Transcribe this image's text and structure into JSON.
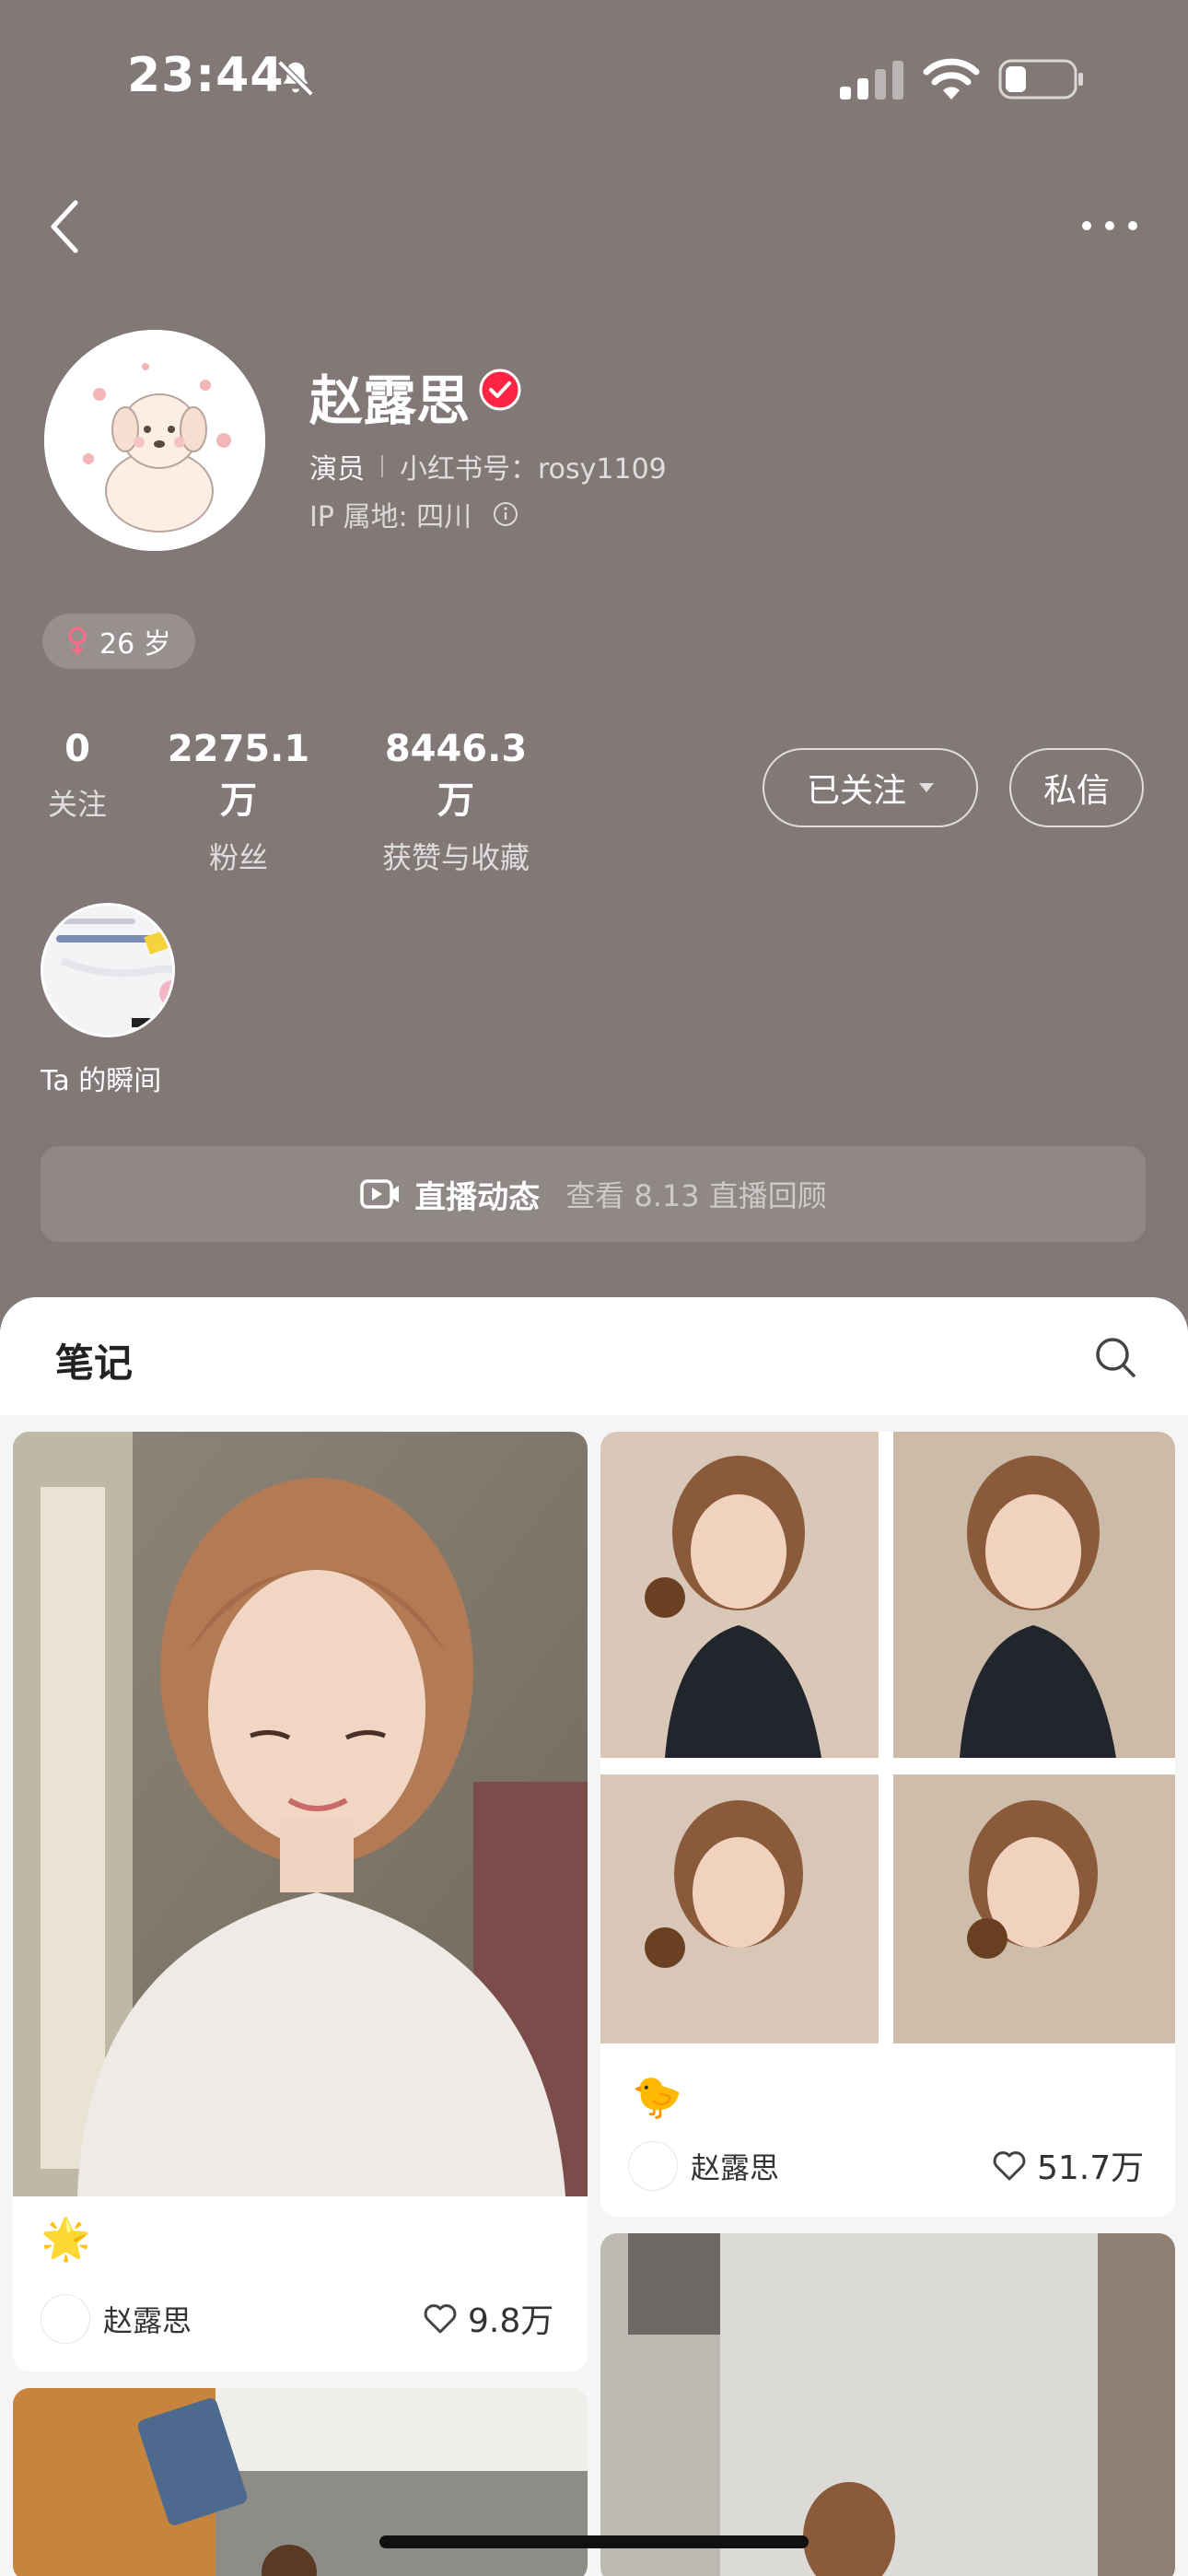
{
  "status_bar": {
    "time": "23:44"
  },
  "profile": {
    "name": "赵露思",
    "role": "演员",
    "redbook_id": "小红书号：rosy1109",
    "ip": "IP 属地: 四川",
    "age": "26 岁"
  },
  "stats": [
    {
      "value": "0",
      "label": "关注"
    },
    {
      "value": "2275.1万",
      "label": "粉丝"
    },
    {
      "value": "8446.3万",
      "label": "获赞与收藏"
    }
  ],
  "buttons": {
    "following": "已关注",
    "message": "私信"
  },
  "moments": {
    "label": "Ta 的瞬间"
  },
  "live_banner": {
    "title": "直播动态",
    "subtitle": "查看 8.13 直播回顾"
  },
  "notes": {
    "tab_label": "笔记",
    "cards": [
      {
        "emoji": "🌟",
        "author": "赵露思",
        "likes": "9.8万"
      },
      {
        "emoji": "🐤",
        "author": "赵露思",
        "likes": "51.7万"
      }
    ]
  },
  "colors": {
    "header_bg": "#817877",
    "verified": "#ff2442",
    "gender": "#ff6b86"
  }
}
